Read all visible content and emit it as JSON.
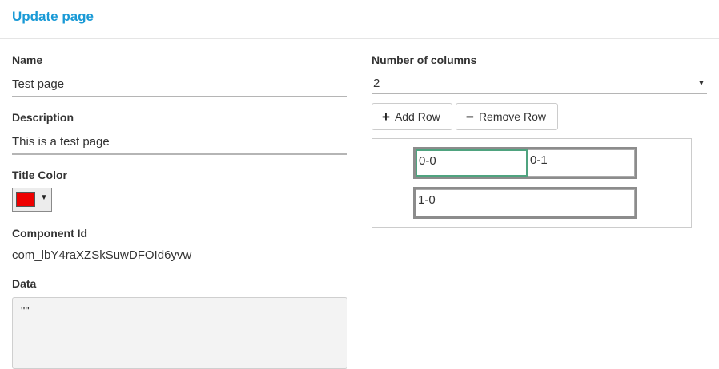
{
  "header": {
    "title": "Update page"
  },
  "form": {
    "name_label": "Name",
    "name_value": "Test page",
    "description_label": "Description",
    "description_value": "This is a test page",
    "title_color_label": "Title Color",
    "title_color_value": "#ee0000",
    "component_id_label": "Component Id",
    "component_id_value": "com_lbY4raXZSkSuwDFOId6yvw",
    "data_label": "Data",
    "data_value": "\"\""
  },
  "layout_editor": {
    "columns_label": "Number of columns",
    "columns_value": "2",
    "add_row_label": "Add Row",
    "remove_row_label": "Remove Row",
    "rows": [
      [
        "0-0",
        "0-1"
      ],
      [
        "1-0"
      ]
    ]
  },
  "colors": {
    "accent": "#1a9ad6",
    "selected_cell_border": "#4fa37f"
  }
}
